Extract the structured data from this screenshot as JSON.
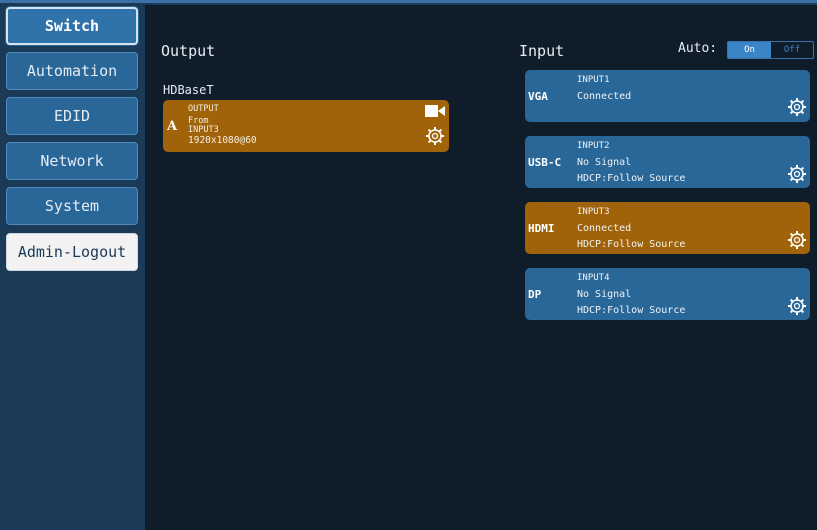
{
  "sidebar": {
    "items": [
      {
        "label": "Switch"
      },
      {
        "label": "Automation"
      },
      {
        "label": "EDID"
      },
      {
        "label": "Network"
      },
      {
        "label": "System"
      },
      {
        "label": "Admin-Logout"
      }
    ]
  },
  "output": {
    "title": "Output",
    "group_label": "HDBaseT",
    "card": {
      "letter": "A",
      "line1": "OUTPUT",
      "line2": "From",
      "line3": "INPUT3",
      "line4": "1920x1080@60"
    }
  },
  "input": {
    "title": "Input",
    "auto_label": "Auto:",
    "auto_on": "On",
    "auto_off": "Off",
    "cards": [
      {
        "name": "VGA",
        "id": "INPUT1",
        "status": "Connected",
        "hdcp": ""
      },
      {
        "name": "USB-C",
        "id": "INPUT2",
        "status": "No Signal",
        "hdcp": "HDCP:Follow Source"
      },
      {
        "name": "HDMI",
        "id": "INPUT3",
        "status": "Connected",
        "hdcp": "HDCP:Follow Source"
      },
      {
        "name": "DP",
        "id": "INPUT4",
        "status": "No Signal",
        "hdcp": "HDCP:Follow Source"
      }
    ]
  },
  "colors": {
    "sidebar_bg": "#1b3a57",
    "main_bg": "#0f1d2b",
    "card_blue": "#2a6799",
    "card_orange": "#a0630a",
    "accent": "#3a84c8"
  },
  "icons": {
    "gear": "gear-icon",
    "camera": "camera-icon"
  }
}
